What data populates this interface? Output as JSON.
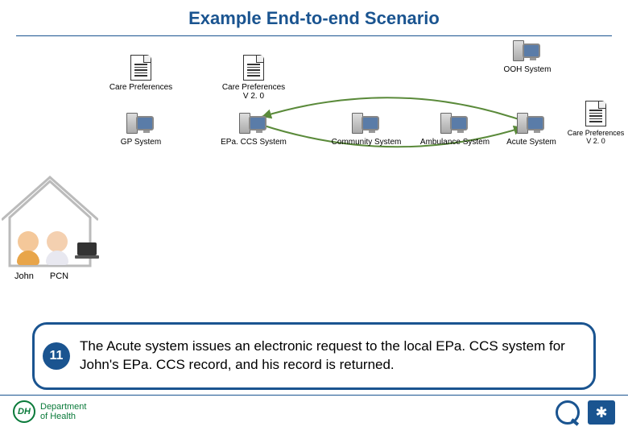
{
  "title": "Example End-to-end Scenario",
  "nodes": {
    "ooh": "OOH System",
    "care_pref_1": "Care Preferences",
    "care_pref_v2_a": "Care Preferences\nV 2. 0",
    "gp": "GP System",
    "epaccs": "EPa. CCS System",
    "community": "Community System",
    "ambulance": "Ambulance System",
    "acute": "Acute System",
    "care_pref_v2_b": "Care Preferences\nV 2. 0"
  },
  "people": {
    "john": "John",
    "pcn": "PCN"
  },
  "step": {
    "number": "11",
    "text": "The Acute system issues an electronic request to the local EPa. CCS system for John's EPa. CCS record, and his record is returned."
  },
  "footer": {
    "dept1": "Department",
    "dept2": "of Health",
    "dh": "DH"
  }
}
